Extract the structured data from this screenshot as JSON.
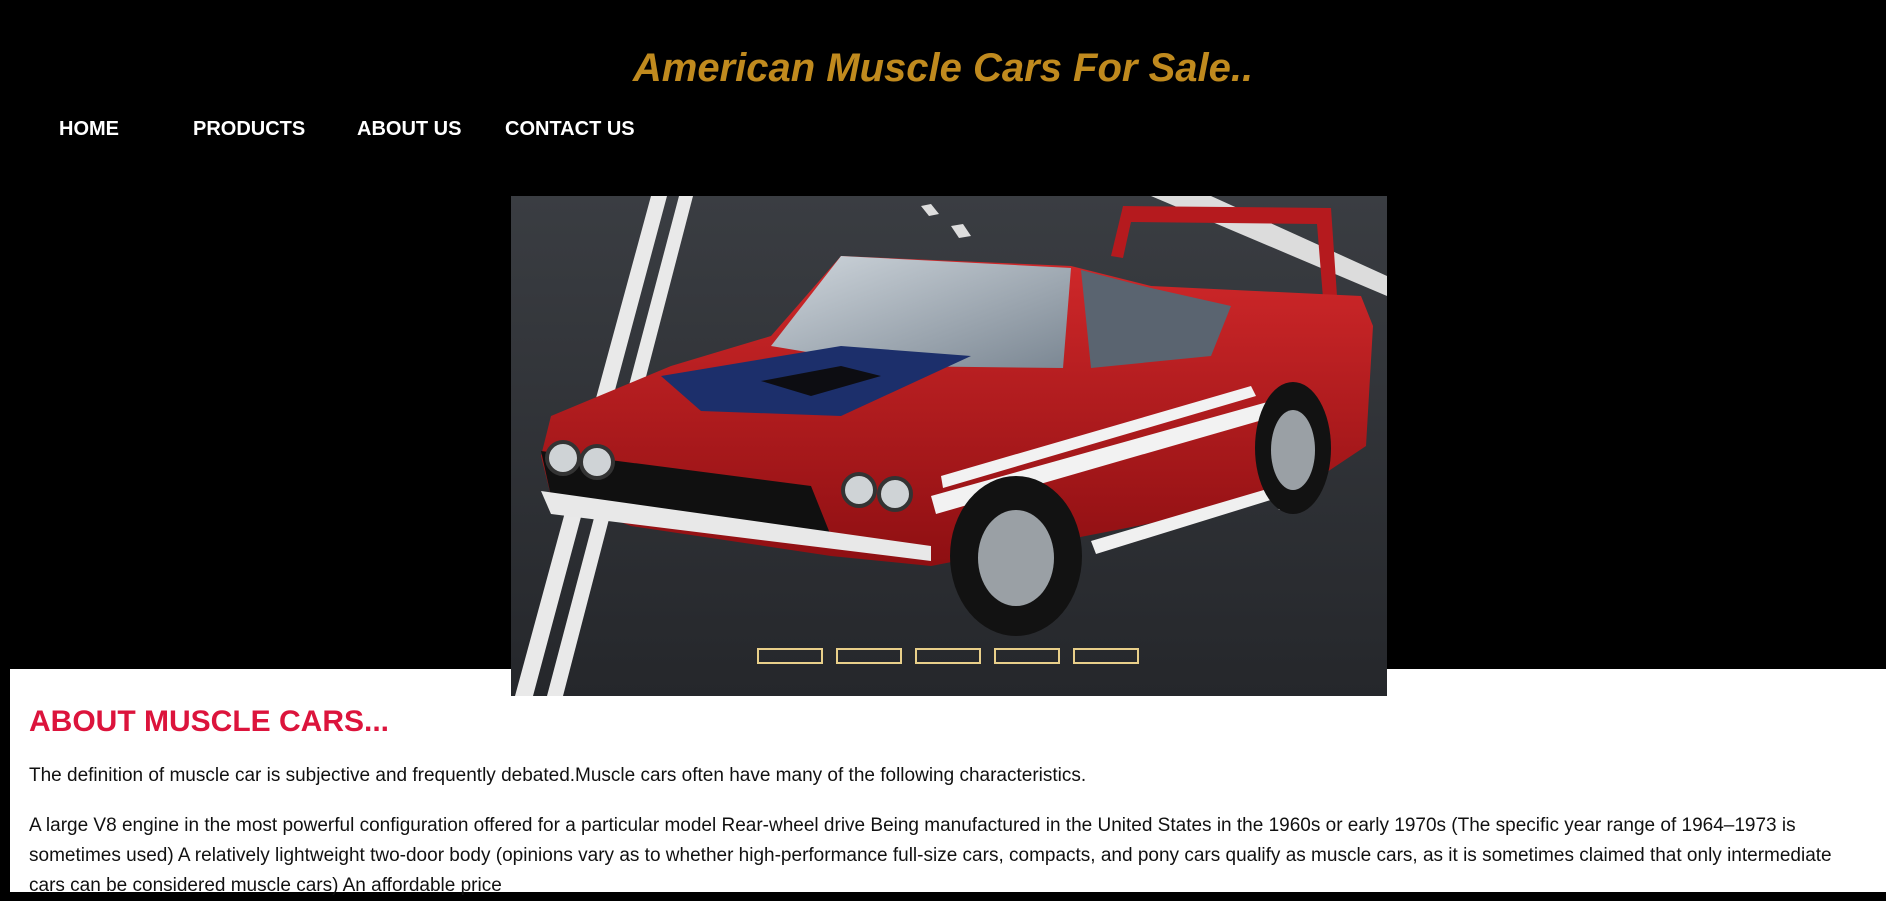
{
  "header": {
    "title": "American Muscle Cars For Sale.."
  },
  "nav": {
    "home": "HOME",
    "products": "PRODUCTS",
    "about": "ABOUT US",
    "contact": "CONTACT US"
  },
  "slider": {
    "image": "red-muscle-car-photo",
    "indicator_count": 5,
    "colors": {
      "indicator_border": "#e8cf8a"
    }
  },
  "about": {
    "heading": "ABOUT MUSCLE CARS...",
    "paragraph1": "The definition of muscle car is subjective and frequently debated.Muscle cars often have many of the following characteristics.",
    "paragraph2": "A large V8 engine in the most powerful configuration offered for a particular model Rear-wheel drive Being manufactured in the United States in the 1960s or early 1970s (The specific year range of 1964–1973 is sometimes used) A relatively lightweight two-door body (opinions vary as to whether high-performance full-size cars, compacts, and pony cars qualify as muscle cars, as it is sometimes claimed that only intermediate cars can be considered muscle cars) An affordable price"
  },
  "colors": {
    "background": "#000000",
    "title": "#c08a1e",
    "nav_text": "#ffffff",
    "heading": "#dc143c",
    "body_text": "#111111"
  }
}
